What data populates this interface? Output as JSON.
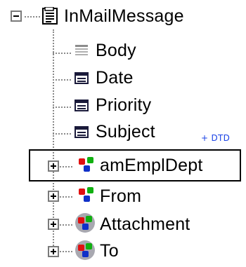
{
  "tree": {
    "root": {
      "label": "InMailMessage",
      "icon": "document-icon",
      "expanded": true
    },
    "children": [
      {
        "label": "Body",
        "icon": "text-element-icon",
        "expander": "none"
      },
      {
        "label": "Date",
        "icon": "simple-element-icon",
        "expander": "none"
      },
      {
        "label": "Priority",
        "icon": "simple-element-icon",
        "expander": "none"
      },
      {
        "label": "Subject",
        "icon": "simple-element-icon",
        "expander": "none",
        "badge": "+ DTD"
      },
      {
        "label": "amEmplDept",
        "icon": "complex-element-icon",
        "expander": "plus",
        "selected": true
      },
      {
        "label": "From",
        "icon": "complex-element-icon",
        "expander": "plus"
      },
      {
        "label": "Attachment",
        "icon": "complex-group-icon",
        "expander": "plus"
      },
      {
        "label": "To",
        "icon": "complex-group-icon",
        "expander": "plus"
      }
    ]
  },
  "colors": {
    "connector": "#8a8a8a",
    "badge": "#1b43e6",
    "red": "#e01010",
    "green": "#10b010",
    "blue": "#1030c8",
    "group_circle": "#a8a8b0"
  }
}
